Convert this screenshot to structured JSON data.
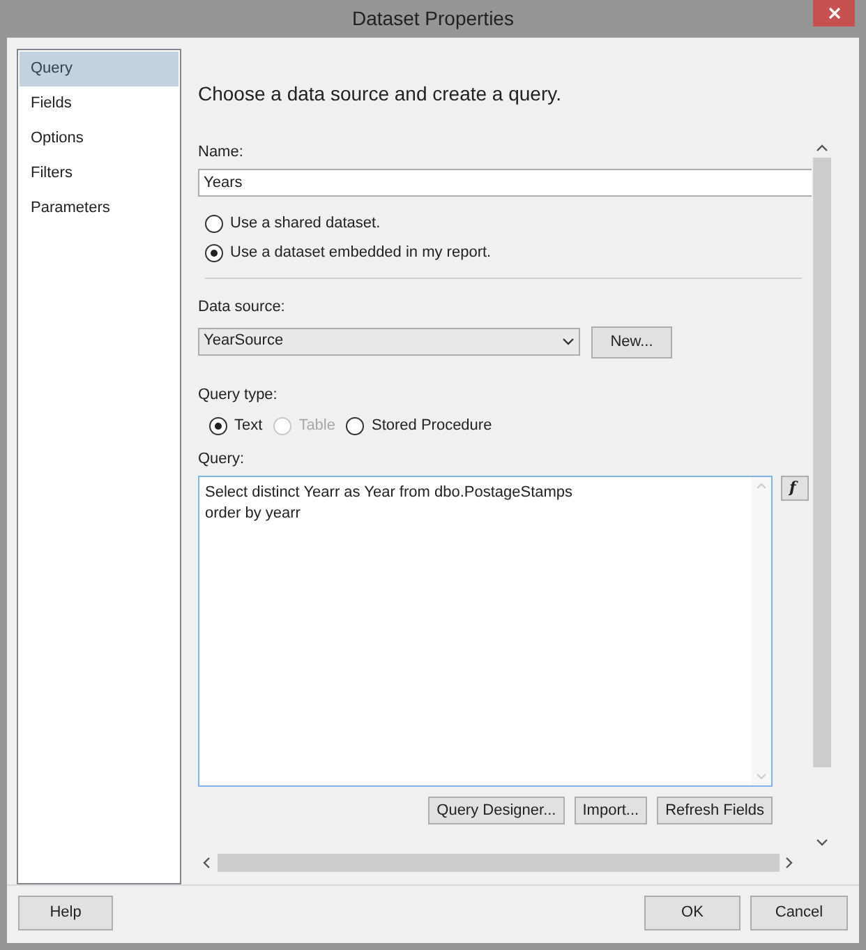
{
  "window": {
    "title": "Dataset Properties"
  },
  "sidebar": {
    "items": [
      {
        "label": "Query",
        "selected": true
      },
      {
        "label": "Fields",
        "selected": false
      },
      {
        "label": "Options",
        "selected": false
      },
      {
        "label": "Filters",
        "selected": false
      },
      {
        "label": "Parameters",
        "selected": false
      }
    ]
  },
  "heading": "Choose a data source and create a query.",
  "name": {
    "label": "Name:",
    "value": "Years"
  },
  "dataset_options": [
    {
      "label": "Use a shared dataset.",
      "selected": false
    },
    {
      "label": "Use a dataset embedded in my report.",
      "selected": true
    }
  ],
  "data_source": {
    "label": "Data source:",
    "value": "YearSource",
    "new_button": "New..."
  },
  "query_type": {
    "label": "Query type:",
    "options": [
      {
        "label": "Text",
        "selected": true,
        "disabled": false
      },
      {
        "label": "Table",
        "selected": false,
        "disabled": true
      },
      {
        "label": "Stored Procedure",
        "selected": false,
        "disabled": false
      }
    ]
  },
  "query": {
    "label": "Query:",
    "lines": [
      "Select distinct Yearr as Year from dbo.PostageStamps",
      "order by yearr"
    ],
    "formula_button": "f"
  },
  "query_buttons": [
    "Query Designer...",
    "Import...",
    "Refresh Fields"
  ],
  "footer": {
    "help": "Help",
    "ok": "OK",
    "cancel": "Cancel"
  }
}
